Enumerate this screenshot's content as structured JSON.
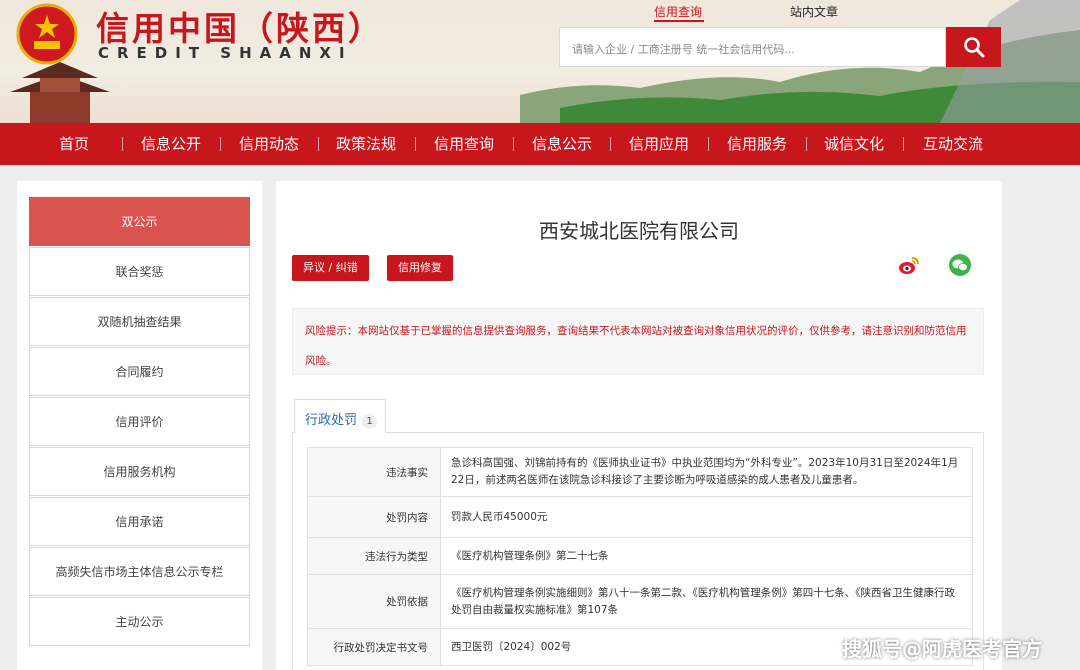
{
  "header": {
    "title": "信用中国（陕西）",
    "subtitle": "CREDIT   SHAANXI",
    "tabs": [
      "信用查询",
      "站内文章"
    ],
    "search_placeholder": "请输入企业 / 工商注册号 统一社会信用代码..."
  },
  "nav": {
    "items": [
      "首页",
      "信息公开",
      "信用动态",
      "政策法规",
      "信用查询",
      "信息公示",
      "信用应用",
      "信用服务",
      "诚信文化",
      "互动交流"
    ]
  },
  "sidebar": {
    "items": [
      {
        "label": "双公示",
        "active": true
      },
      {
        "label": "联合奖惩"
      },
      {
        "label": "双随机抽查结果"
      },
      {
        "label": "合同履约"
      },
      {
        "label": "信用评价"
      },
      {
        "label": "信用服务机构"
      },
      {
        "label": "信用承诺"
      },
      {
        "label": "高频失信市场主体信息公示专栏"
      },
      {
        "label": "主动公示"
      }
    ]
  },
  "main": {
    "company_name": "西安城北医院有限公司",
    "buttons": {
      "objection": "异议 / 纠错",
      "repair": "信用修复"
    },
    "share_icons": [
      "weibo-icon",
      "wechat-icon"
    ],
    "risk_notice": "风险提示：本网站仅基于已掌握的信息提供查询服务，查询结果不代表本网站对被查询对象信用状况的评价，仅供参考，请注意识别和防范信用风险。",
    "section": {
      "label": "行政处罚",
      "count": "1"
    },
    "details": [
      {
        "key": "违法事实",
        "value": "急诊科高国强、刘锦前持有的《医师执业证书》中执业范围均为“外科专业”。2023年10月31日至2024年1月22日，前述两名医师在该院急诊科接诊了主要诊断为呼吸道感染的成人患者及儿童患者。"
      },
      {
        "key": "处罚内容",
        "value": "罚款人民币45000元"
      },
      {
        "key": "违法行为类型",
        "value": "《医疗机构管理条例》第二十七条"
      },
      {
        "key": "处罚依据",
        "value": "《医疗机构管理条例实施细则》第八十一条第二款、《医疗机构管理条例》第四十七条、《陕西省卫生健康行政处罚自由裁量权实施标准》第107条"
      },
      {
        "key": "行政处罚决定书文号",
        "value": "西卫医罚〔2024〕002号"
      }
    ]
  },
  "watermark": "搜狐号@阿虎医考官方",
  "colors": {
    "brand_red": "#c8161d",
    "active_side": "#d9534f",
    "tab_blue": "#2b6bb5"
  }
}
